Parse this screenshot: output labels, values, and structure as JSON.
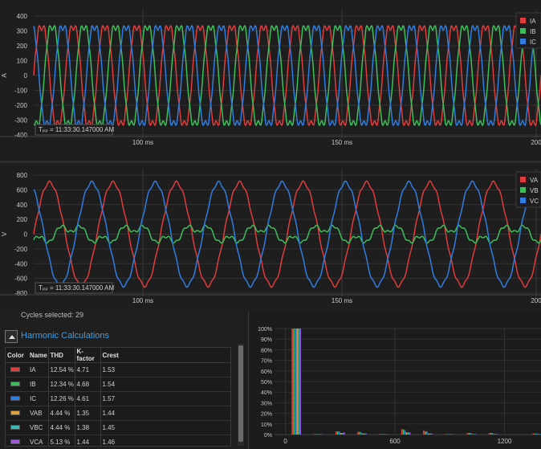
{
  "chart_data": [
    {
      "type": "line",
      "ylabel": "A",
      "ylim": [
        -400,
        400
      ],
      "yticks": [
        400,
        300,
        200,
        100,
        0,
        -100,
        -200,
        -300,
        -400
      ],
      "xticks": [
        "100 ms",
        "150 ms",
        "200"
      ],
      "cursor_label": "Tₚₚ = 11:33:30.147000 AM",
      "series": [
        {
          "name": "IA",
          "color": "#e03c3c",
          "amplitude": 320,
          "phase_deg": 0
        },
        {
          "name": "IB",
          "color": "#3cbf5a",
          "amplitude": 320,
          "phase_deg": -120
        },
        {
          "name": "IC",
          "color": "#2f7de0",
          "amplitude": 320,
          "phase_deg": 120
        }
      ]
    },
    {
      "type": "line",
      "ylabel": "V",
      "ylim": [
        -800,
        800
      ],
      "yticks": [
        800,
        600,
        400,
        200,
        0,
        -200,
        -400,
        -600,
        -800
      ],
      "xticks": [
        "100 ms",
        "150 ms",
        "200"
      ],
      "cursor_label": "Tₚₚ = 11:33:30.147000 AM",
      "series": [
        {
          "name": "VA",
          "color": "#e03c3c",
          "amplitude": 700,
          "phase_deg": 0
        },
        {
          "name": "VB",
          "color": "#3cbf5a",
          "amplitude": 150,
          "phase_deg": -120
        },
        {
          "name": "VC",
          "color": "#2f7de0",
          "amplitude": 700,
          "phase_deg": 120
        }
      ]
    },
    {
      "type": "bar",
      "ylim": [
        0,
        100
      ],
      "yticks": [
        "100%",
        "90%",
        "80%",
        "70%",
        "60%",
        "50%",
        "40%",
        "30%",
        "20%",
        "10%",
        "0%"
      ],
      "xticks": [
        "0",
        "600",
        "1200"
      ],
      "xlim": [
        -60,
        1400
      ],
      "series_colors": [
        "#e03c3c",
        "#3cbf5a",
        "#2f7de0",
        "#e0a23c",
        "#3cb8b8",
        "#a05ae0"
      ],
      "groups": [
        {
          "freq": 60,
          "values": [
            100,
            100,
            100,
            100,
            100,
            100
          ]
        },
        {
          "freq": 180,
          "values": [
            0.5,
            0.5,
            0.5,
            0.3,
            0.3,
            0.3
          ]
        },
        {
          "freq": 300,
          "values": [
            3,
            3,
            3,
            1.5,
            1.5,
            2
          ]
        },
        {
          "freq": 420,
          "values": [
            2.5,
            2.5,
            2,
            1,
            1,
            1
          ]
        },
        {
          "freq": 540,
          "values": [
            0.5,
            0.5,
            0.5,
            0.3,
            0.3,
            0.3
          ]
        },
        {
          "freq": 660,
          "values": [
            5,
            5,
            4,
            2,
            2,
            2
          ]
        },
        {
          "freq": 780,
          "values": [
            4,
            3,
            3,
            1,
            1,
            1
          ]
        },
        {
          "freq": 900,
          "values": [
            0.4,
            0.4,
            0.4,
            0.3,
            0.3,
            0.3
          ]
        },
        {
          "freq": 1020,
          "values": [
            1.5,
            1.5,
            1.5,
            0.5,
            0.5,
            0.5
          ]
        },
        {
          "freq": 1140,
          "values": [
            1.5,
            1.5,
            1.5,
            0.5,
            0.5,
            0.5
          ]
        },
        {
          "freq": 1380,
          "values": [
            1,
            1,
            1,
            0.5,
            0.5,
            0.5
          ]
        }
      ]
    }
  ],
  "harmonics": {
    "cycles_selected": "Cycles selected: 29",
    "title": "Harmonic Calculations",
    "columns": [
      "Color",
      "Name",
      "THD",
      "K-factor",
      "Crest"
    ],
    "rows": [
      {
        "color": "#e03c3c",
        "name": "IA",
        "thd": "12.54 %",
        "kfactor": "4.71",
        "crest": "1.53"
      },
      {
        "color": "#3cbf5a",
        "name": "IB",
        "thd": "12.34 %",
        "kfactor": "4.68",
        "crest": "1.54"
      },
      {
        "color": "#2f7de0",
        "name": "IC",
        "thd": "12.26 %",
        "kfactor": "4.61",
        "crest": "1.57"
      },
      {
        "color": "#e0a23c",
        "name": "VAB",
        "thd": "4.44 %",
        "kfactor": "1.35",
        "crest": "1.44"
      },
      {
        "color": "#3cb8b8",
        "name": "VBC",
        "thd": "4.44 %",
        "kfactor": "1.38",
        "crest": "1.45"
      },
      {
        "color": "#a05ae0",
        "name": "VCA",
        "thd": "5.13 %",
        "kfactor": "1.44",
        "crest": "1.46"
      }
    ]
  }
}
